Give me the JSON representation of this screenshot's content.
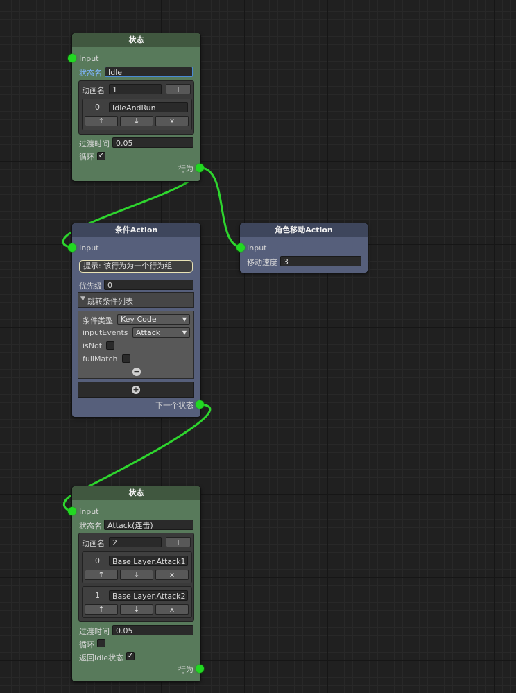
{
  "nodes": {
    "state1": {
      "title": "状态",
      "input": "Input",
      "name_label": "状态名",
      "name_value": "Idle",
      "anim_label": "动画名",
      "anim_count": "1",
      "plus": "+",
      "items": [
        {
          "index": "0",
          "value": "IdleAndRun"
        }
      ],
      "up": "↑",
      "down": "↓",
      "remove": "x",
      "transition_label": "过渡时间",
      "transition_value": "0.05",
      "loop_label": "循环",
      "loop_checked": "✓",
      "output": "行为"
    },
    "condition": {
      "title": "条件Action",
      "input": "Input",
      "hint": "提示: 该行为为一个行为组",
      "priority_label": "优先级",
      "priority_value": "0",
      "list_label": "跳转条件列表",
      "cond_type_label": "条件类型",
      "cond_type_value": "Key Code",
      "input_events_label": "inputEvents",
      "input_events_value": "Attack",
      "is_not_label": "isNot",
      "full_match_label": "fullMatch",
      "minus": "−",
      "plus": "+",
      "output": "下一个状态"
    },
    "move": {
      "title": "角色移动Action",
      "input": "Input",
      "speed_label": "移动速度",
      "speed_value": "3"
    },
    "state2": {
      "title": "状态",
      "input": "Input",
      "name_label": "状态名",
      "name_value": "Attack(连击)",
      "anim_label": "动画名",
      "anim_count": "2",
      "plus": "+",
      "items": [
        {
          "index": "0",
          "value": "Base Layer.Attack1"
        },
        {
          "index": "1",
          "value": "Base Layer.Attack2"
        }
      ],
      "up": "↑",
      "down": "↓",
      "remove": "x",
      "transition_label": "过渡时间",
      "transition_value": "0.05",
      "loop_label": "循环",
      "return_label": "返回Idle状态",
      "return_checked": "✓",
      "output": "行为"
    }
  },
  "colors": {
    "state_node": "#587a5b",
    "action_node": "#565f7b",
    "wire": "#2ed62e",
    "port": "#22d822"
  }
}
